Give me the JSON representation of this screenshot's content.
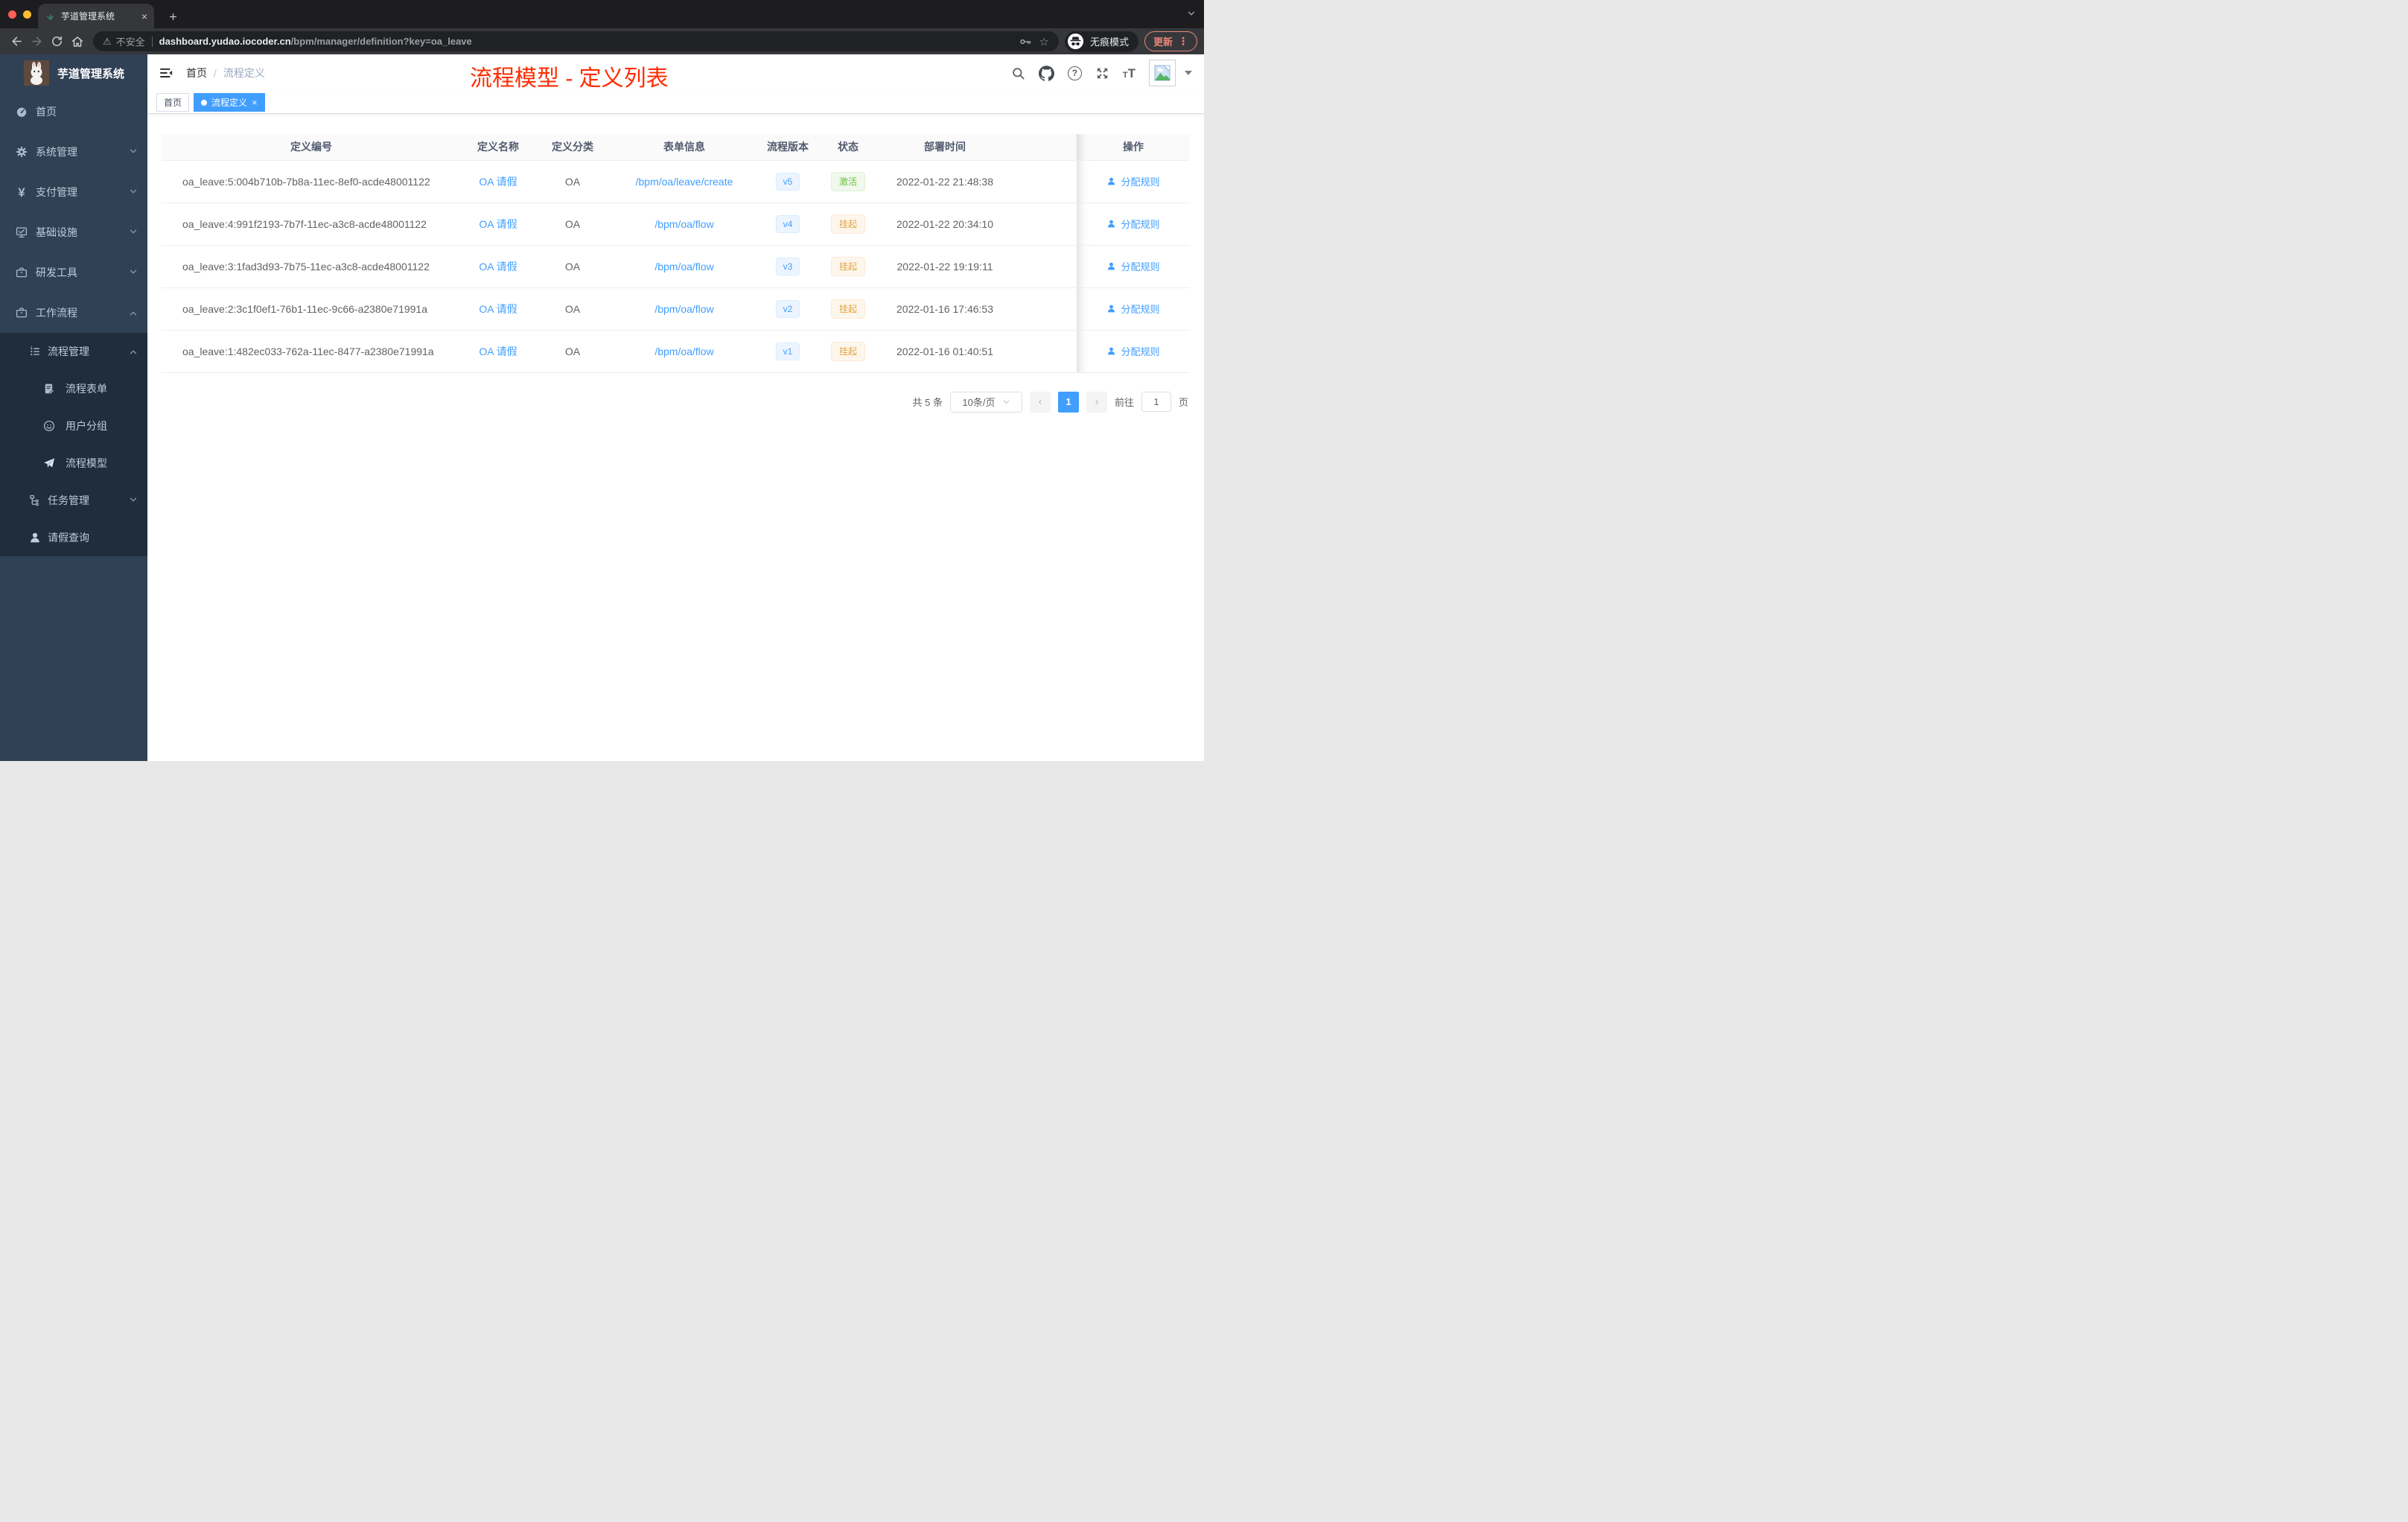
{
  "browser": {
    "tab_title": "芋道管理系统",
    "security_label": "不安全",
    "url_host": "dashboard.yudao.iocoder.cn",
    "url_path": "/bpm/manager/definition?key=oa_leave",
    "incognito_label": "无痕模式",
    "update_label": "更新"
  },
  "icons": {
    "tab_close": "×",
    "new_tab_plus": "+",
    "warning": "⚠",
    "star": "☆",
    "more_vertical": "⋮",
    "yen": "¥",
    "question": "?",
    "font_small": "T",
    "font_large": "T",
    "tag_close": "×",
    "prev": "‹",
    "next": "›"
  },
  "sidebar": {
    "logo_title": "芋道管理系统",
    "menu": [
      {
        "label": "首页"
      },
      {
        "label": "系统管理"
      },
      {
        "label": "支付管理"
      },
      {
        "label": "基础设施"
      },
      {
        "label": "研发工具"
      },
      {
        "label": "工作流程"
      },
      {
        "label": "流程管理"
      },
      {
        "label": "流程表单"
      },
      {
        "label": "用户分组"
      },
      {
        "label": "流程模型"
      },
      {
        "label": "任务管理"
      },
      {
        "label": "请假查询"
      }
    ]
  },
  "navbar": {
    "breadcrumb_home": "首页",
    "breadcrumb_separator": "/",
    "breadcrumb_current": "流程定义"
  },
  "annotation": "流程模型 - 定义列表",
  "tags": {
    "home": "首页",
    "current": "流程定义"
  },
  "table": {
    "columns": [
      "定义编号",
      "定义名称",
      "定义分类",
      "表单信息",
      "流程版本",
      "状态",
      "部署时间",
      "操作"
    ],
    "rows": [
      {
        "id": "oa_leave:5:004b710b-7b8a-11ec-8ef0-acde48001122",
        "name": "OA 请假",
        "category": "OA",
        "form": "/bpm/oa/leave/create",
        "version": "v5",
        "status": "激活",
        "status_type": "success",
        "deployed_at": "2022-01-22 21:48:38",
        "action": "分配规则"
      },
      {
        "id": "oa_leave:4:991f2193-7b7f-11ec-a3c8-acde48001122",
        "name": "OA 请假",
        "category": "OA",
        "form": "/bpm/oa/flow",
        "version": "v4",
        "status": "挂起",
        "status_type": "warning",
        "deployed_at": "2022-01-22 20:34:10",
        "action": "分配规则"
      },
      {
        "id": "oa_leave:3:1fad3d93-7b75-11ec-a3c8-acde48001122",
        "name": "OA 请假",
        "category": "OA",
        "form": "/bpm/oa/flow",
        "version": "v3",
        "status": "挂起",
        "status_type": "warning",
        "deployed_at": "2022-01-22 19:19:11",
        "action": "分配规则"
      },
      {
        "id": "oa_leave:2:3c1f0ef1-76b1-11ec-9c66-a2380e71991a",
        "name": "OA 请假",
        "category": "OA",
        "form": "/bpm/oa/flow",
        "version": "v2",
        "status": "挂起",
        "status_type": "warning",
        "deployed_at": "2022-01-16 17:46:53",
        "action": "分配规则"
      },
      {
        "id": "oa_leave:1:482ec033-762a-11ec-8477-a2380e71991a",
        "name": "OA 请假",
        "category": "OA",
        "form": "/bpm/oa/flow",
        "version": "v1",
        "status": "挂起",
        "status_type": "warning",
        "deployed_at": "2022-01-16 01:40:51",
        "action": "分配规则"
      }
    ]
  },
  "pagination": {
    "total": "共 5 条",
    "page_size": "10条/页",
    "current_page": "1",
    "goto_label": "前往",
    "goto_value": "1",
    "page_unit": "页"
  },
  "colors": {
    "accent": "#409eff",
    "annotation_red": "#fe2c01",
    "success_green": "#67c23a",
    "warning_orange": "#e6a23c",
    "sidebar_bg": "#304156",
    "submenu_bg": "#1f2d3d"
  }
}
